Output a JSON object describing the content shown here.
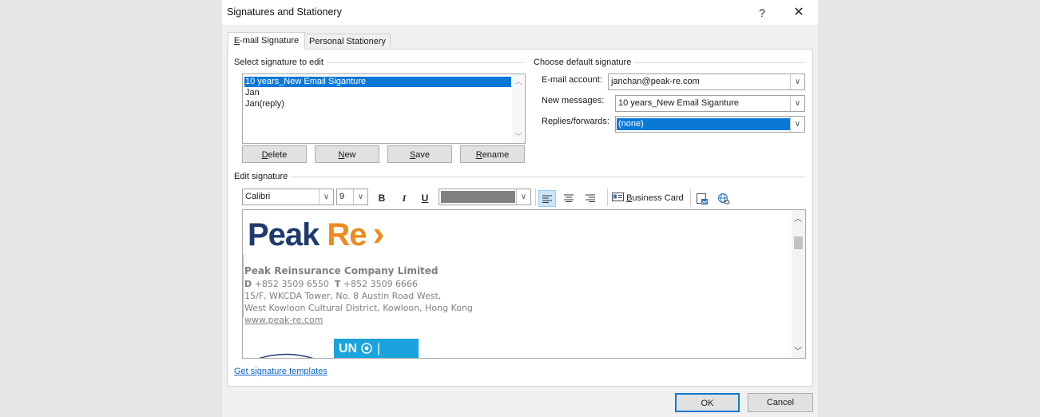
{
  "dialog": {
    "title": "Signatures and Stationery",
    "help_label": "?",
    "close_label": "✕"
  },
  "tabs": [
    {
      "label": "E-mail Signature",
      "mnemonic": "E",
      "rest": "-mail Signature"
    },
    {
      "label": "Personal Stationery"
    }
  ],
  "left": {
    "group_label": "Select signature to edit",
    "signatures": [
      "10 years_New Email Siganture",
      "Jan",
      "Jan(reply)"
    ],
    "buttons": {
      "delete": {
        "label": "Delete",
        "mnemonic": "D",
        "rest": "elete"
      },
      "new": {
        "label": "New",
        "mnemonic": "N",
        "rest": "ew"
      },
      "save": {
        "label": "Save",
        "mnemonic": "S",
        "rest": "ave"
      },
      "rename": {
        "label": "Rename",
        "mnemonic": "R",
        "rest": "ename"
      }
    }
  },
  "right": {
    "group_label": "Choose default signature",
    "email_account_label": "E-mail account:",
    "email_account_value": "janchan@peak-re.com",
    "new_messages_label": "New messages:",
    "new_messages_value": "10 years_New Email Siganture",
    "replies_label": "Replies/forwards:",
    "replies_value": "(none)"
  },
  "edit": {
    "group_label": "Edit signature",
    "font_name": "Calibri",
    "font_size": "9",
    "bold_label": "B",
    "italic_label": "I",
    "underline_label": "U",
    "text_color": "#808080",
    "business_card_label": "Business Card",
    "business_card_mnemonic": "B",
    "business_card_rest": "usiness Card"
  },
  "signature": {
    "logo_text_dark": "Peak",
    "logo_text_orange": "Re",
    "logo_chevron": "›",
    "company": "Peak Reinsurance Company Limited",
    "phone_line": {
      "d_label": "D",
      "d_value": "+852 3509 6550",
      "t_label": "T",
      "t_value": "+852 3509 6666"
    },
    "address1": "15/F, WKCDA Tower, No. 8 Austin Road West,",
    "address2": "West Kowloon Cultural District, Kowloon, Hong Kong",
    "website": "www.peak-re.com",
    "un_badge": "UN",
    "colors": {
      "dark": "#1f3a6e",
      "orange": "#f08a1e",
      "un_blue": "#1aa3dd"
    }
  },
  "footer": {
    "templates_link": "Get signature templates",
    "ok_label": "OK",
    "cancel_label": "Cancel"
  }
}
